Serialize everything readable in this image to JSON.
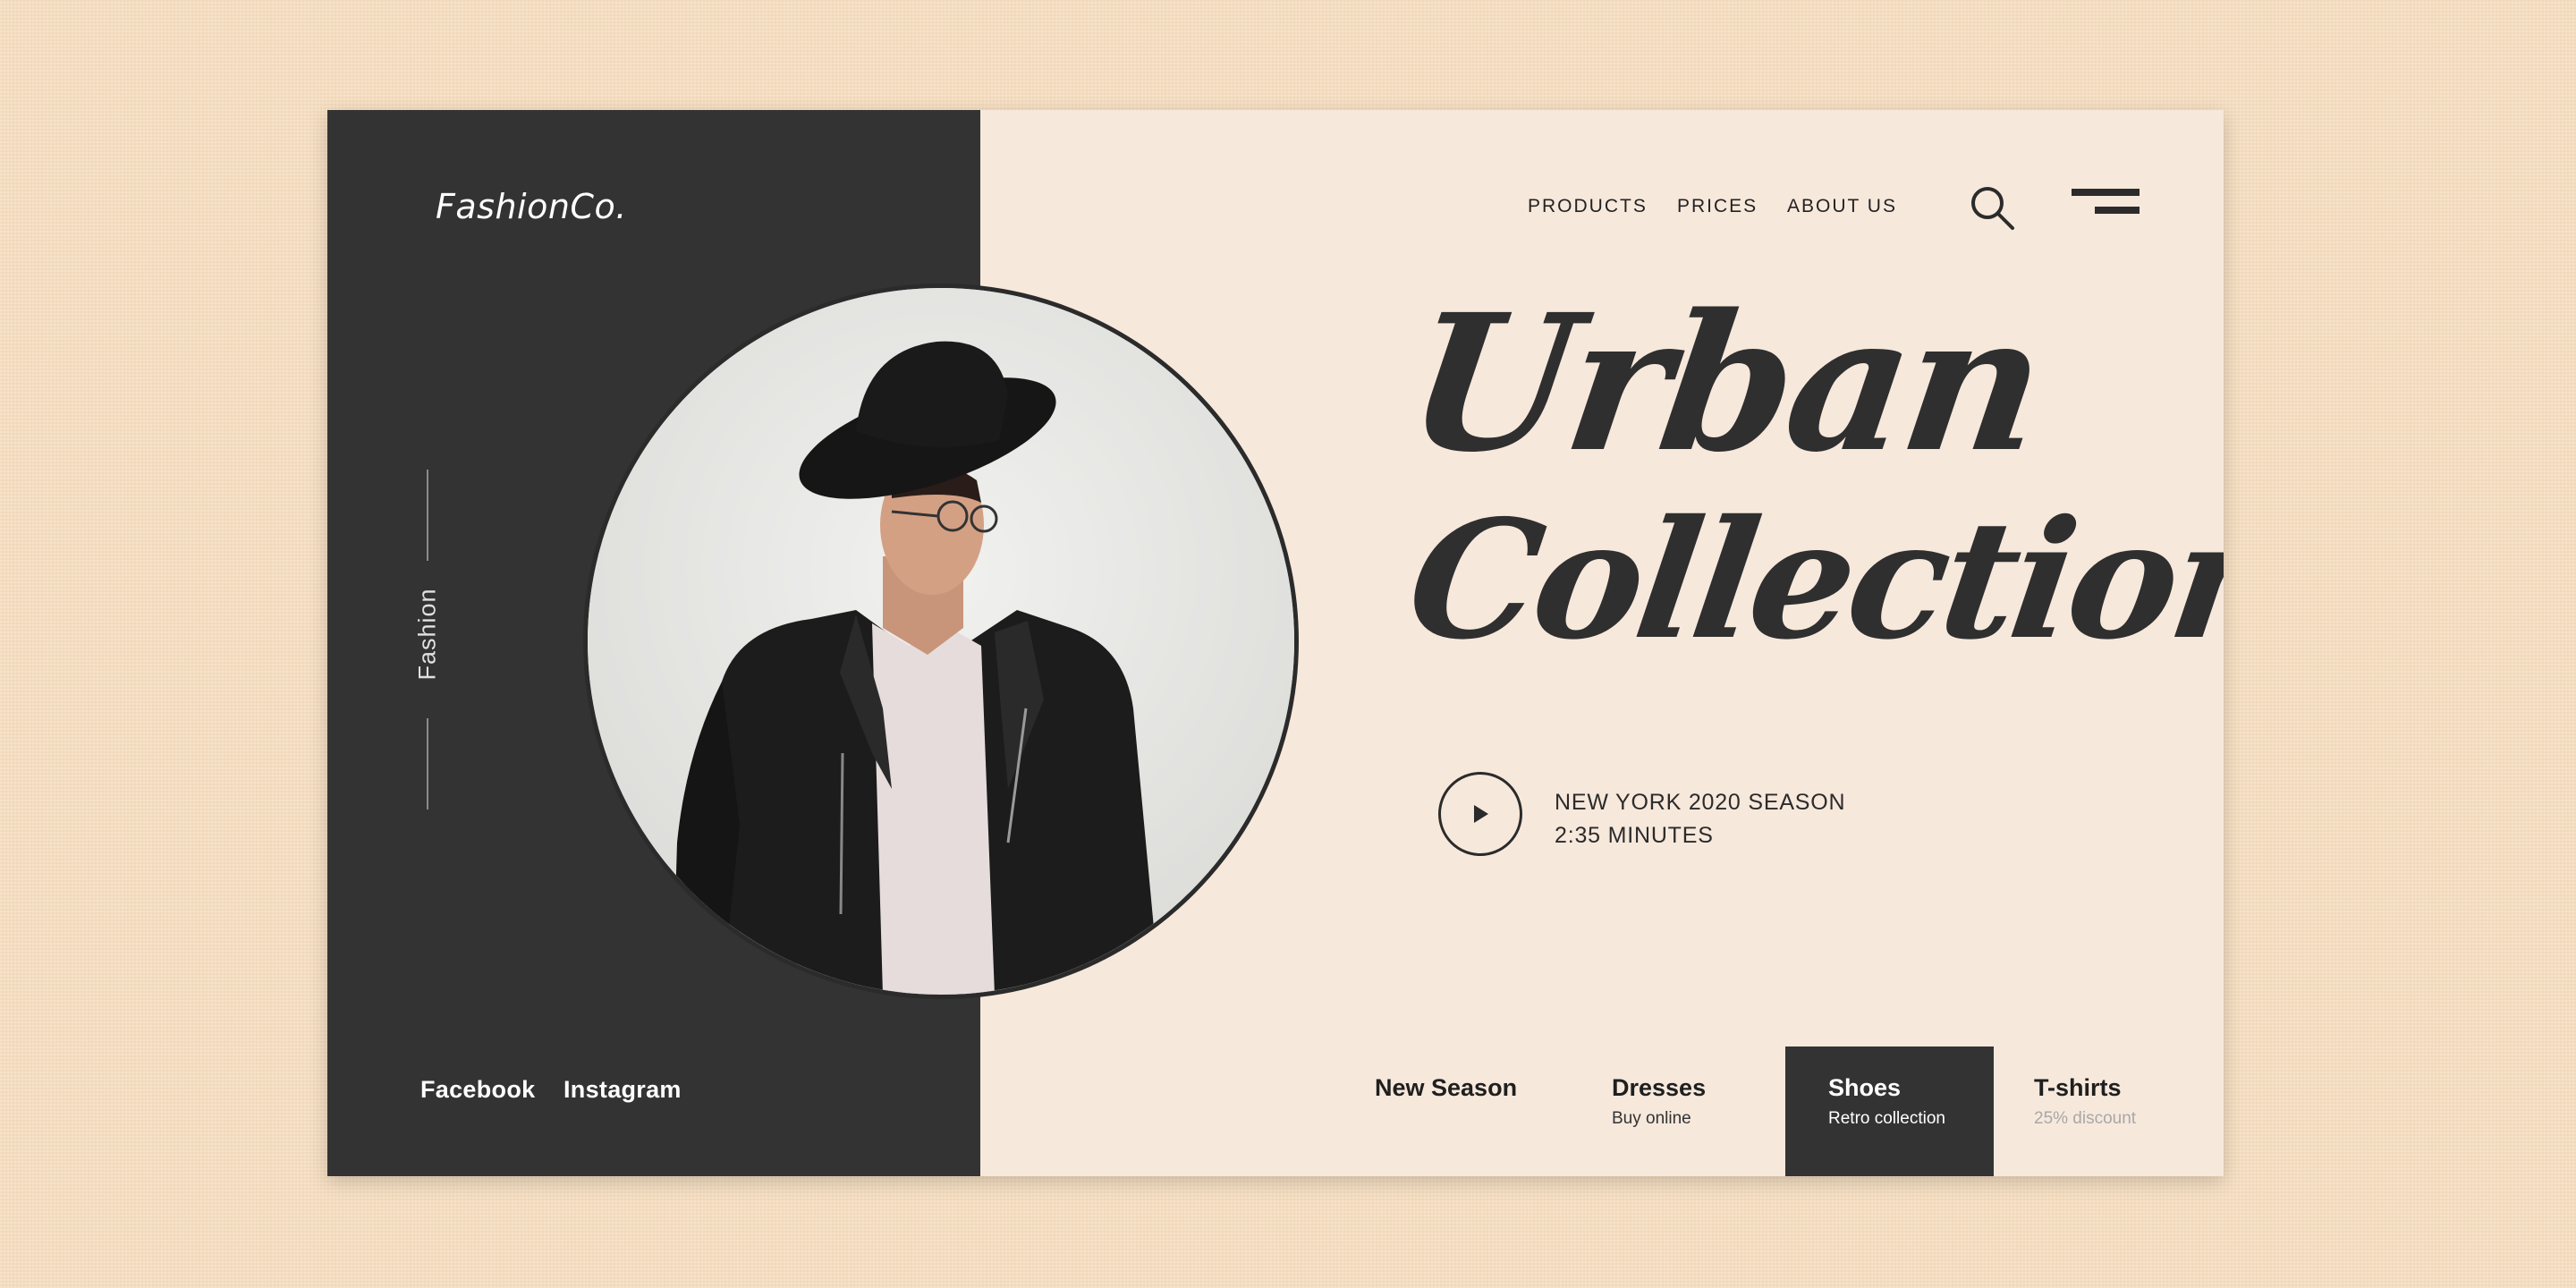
{
  "brand": {
    "logo": "FashionCo."
  },
  "sidebar": {
    "vertical_label": "Fashion"
  },
  "nav": {
    "items": [
      "PRODUCTS",
      "PRICES",
      "ABOUT US"
    ]
  },
  "hero": {
    "headline_line1": "Urban",
    "headline_line2": "Collection",
    "video": {
      "line1": "NEW YORK 2020 SEASON",
      "line2": "2:35 MINUTES"
    }
  },
  "social": {
    "facebook": "Facebook",
    "instagram": "Instagram"
  },
  "categories": [
    {
      "title": "New Season",
      "subtitle": ""
    },
    {
      "title": "Dresses",
      "subtitle": "Buy online"
    },
    {
      "title": "Shoes",
      "subtitle": "Retro collection",
      "active": true
    },
    {
      "title": "T-shirts",
      "subtitle": "25% discount"
    }
  ],
  "colors": {
    "dark": "#333333",
    "cream": "#f7e8dc",
    "background": "#f7dec0"
  },
  "icons": {
    "search": "search-icon",
    "menu": "menu-icon",
    "play": "play-icon"
  }
}
